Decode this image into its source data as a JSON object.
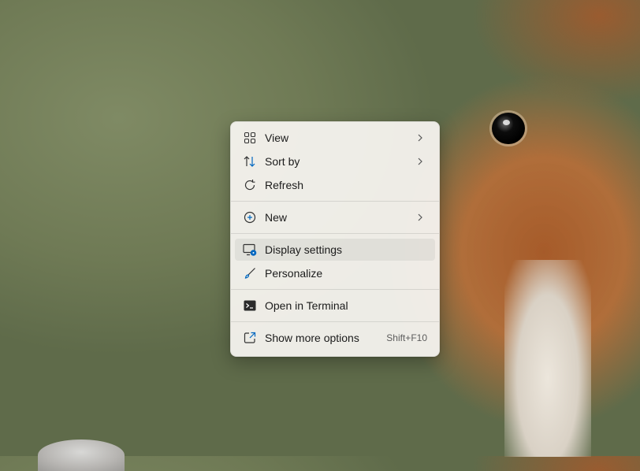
{
  "context_menu": {
    "items": [
      {
        "label": "View",
        "icon": "grid-icon"
      },
      {
        "label": "Sort by",
        "icon": "sort-arrows-icon"
      },
      {
        "label": "Refresh",
        "icon": "refresh-icon"
      },
      {
        "label": "New",
        "icon": "plus-circle-icon"
      },
      {
        "label": "Display settings",
        "icon": "display-settings-icon"
      },
      {
        "label": "Personalize",
        "icon": "brush-icon"
      },
      {
        "label": "Open in Terminal",
        "icon": "terminal-icon"
      },
      {
        "label": "Show more options",
        "icon": "share-box-icon",
        "shortcut": "Shift+F10"
      }
    ]
  },
  "colors": {
    "accent": "#0067c0",
    "menu_bg": "#f7f4f0",
    "hover_bg": "#ebe8e4"
  }
}
